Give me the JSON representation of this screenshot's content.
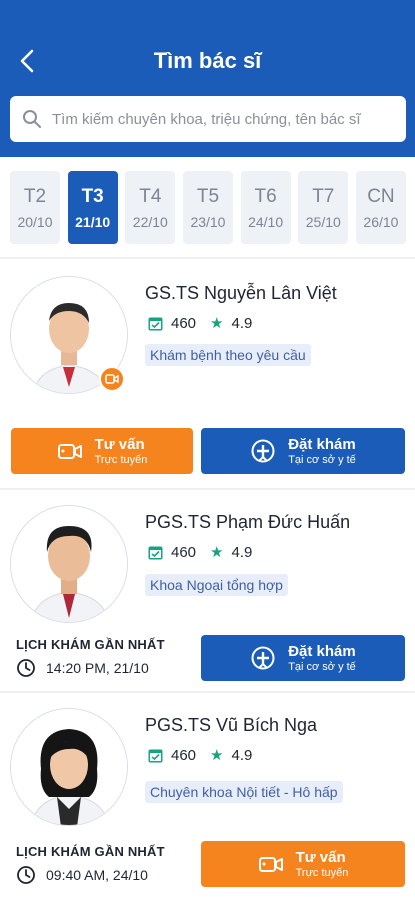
{
  "header": {
    "title": "Tìm bác sĩ",
    "search_placeholder": "Tìm kiếm chuyên khoa, triệu chứng, tên bác sĩ"
  },
  "dates": [
    {
      "day": "T2",
      "date": "20/10",
      "active": false
    },
    {
      "day": "T3",
      "date": "21/10",
      "active": true
    },
    {
      "day": "T4",
      "date": "22/10",
      "active": false
    },
    {
      "day": "T5",
      "date": "23/10",
      "active": false
    },
    {
      "day": "T6",
      "date": "24/10",
      "active": false
    },
    {
      "day": "T7",
      "date": "25/10",
      "active": false
    },
    {
      "day": "CN",
      "date": "26/10",
      "active": false
    }
  ],
  "doctors": [
    {
      "name": "GS.TS Nguyễn Lân Việt",
      "bookings": "460",
      "rating": "4.9",
      "specialty": "Khám bệnh theo yêu cầu",
      "consult": {
        "title": "Tư vấn",
        "subtitle": "Trực tuyến"
      },
      "book": {
        "title": "Đặt khám",
        "subtitle": "Tại cơ sở y tế"
      }
    },
    {
      "name": "PGS.TS Phạm Đức Huấn",
      "bookings": "460",
      "rating": "4.9",
      "specialty": "Khoa Ngoại tổng hợp",
      "next_label": "LỊCH KHÁM GẦN NHẤT",
      "next_time": "14:20 PM, 21/10",
      "book": {
        "title": "Đặt khám",
        "subtitle": "Tại cơ sở y tế"
      }
    },
    {
      "name": "PGS.TS Vũ Bích Nga",
      "bookings": "460",
      "rating": "4.9",
      "specialty": "Chuyên khoa Nội tiết - Hô hấp",
      "next_label": "LỊCH KHÁM GẦN NHẤT",
      "next_time": "09:40 AM, 24/10",
      "consult": {
        "title": "Tư vấn",
        "subtitle": "Trực tuyến"
      }
    }
  ],
  "colors": {
    "primary": "#1a5cb8",
    "accent": "#f5841f",
    "star": "#16a37f"
  }
}
